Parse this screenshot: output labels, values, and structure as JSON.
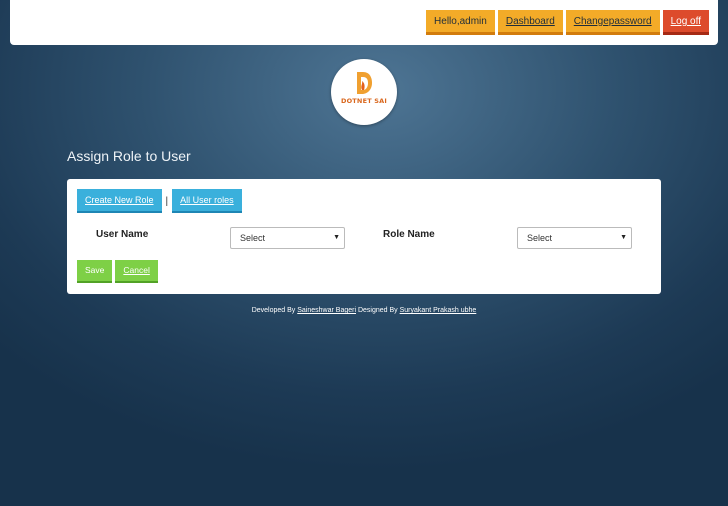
{
  "header": {
    "greeting": "Hello,admin",
    "dashboard": "Dashboard",
    "change_password": "Changepassword",
    "log_off": "Log off"
  },
  "logo": {
    "text": "DOTNET SAI"
  },
  "page": {
    "title": "Assign Role to User"
  },
  "card": {
    "create_role": "Create New Role",
    "separator": "|",
    "all_roles": "All User roles",
    "user_name_label": "User Name",
    "user_select_value": "Select",
    "role_name_label": "Role Name",
    "role_select_value": "Select",
    "save": "Save",
    "cancel": "Cancel"
  },
  "footer": {
    "developed_prefix": "Developed By",
    "developer": "Saineshwar Bageri",
    "designed_prefix": "Designed By",
    "designer": "Suryakant Prakash ubhe"
  },
  "colors": {
    "nav_orange": "#f3ab28",
    "logoff_red": "#dd4b2c",
    "link_blue": "#3ab0dc",
    "action_green": "#7ed046",
    "bg_dark": "#1d3a55"
  }
}
